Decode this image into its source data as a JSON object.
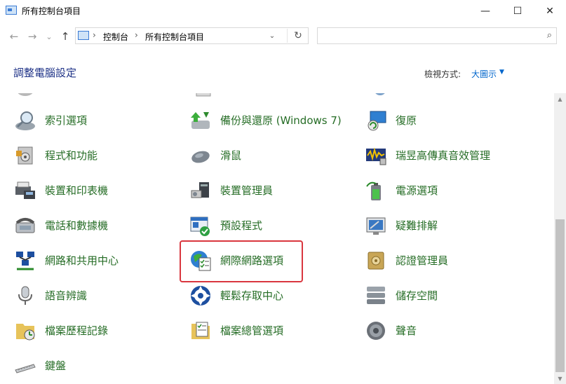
{
  "window": {
    "title": "所有控制台項目",
    "minimize": "—",
    "maximize": "☐",
    "close": "✕"
  },
  "nav": {
    "back": "←",
    "forward": "→",
    "recent": "⌄",
    "up": "↑"
  },
  "address": {
    "crumb1": "控制台",
    "crumb2": "所有控制台項目",
    "sep": "›",
    "dropdown": "⌄",
    "refresh": "↻"
  },
  "search": {
    "placeholder": "",
    "icon": "⌕"
  },
  "header": {
    "title": "調整電腦設定",
    "view_by_label": "檢視方式:",
    "view_by_value": "大圖示",
    "caret": "▼"
  },
  "items": [
    {
      "label": "索引選項",
      "icon": "search-index-icon"
    },
    {
      "label": "備份與還原 (Windows 7)",
      "icon": "backup-restore-icon"
    },
    {
      "label": "復原",
      "icon": "recovery-icon"
    },
    {
      "label": "程式和功能",
      "icon": "programs-features-icon"
    },
    {
      "label": "滑鼠",
      "icon": "mouse-icon"
    },
    {
      "label": "瑞昱高傳真音效管理",
      "icon": "realtek-audio-icon"
    },
    {
      "label": "裝置和印表機",
      "icon": "devices-printers-icon"
    },
    {
      "label": "裝置管理員",
      "icon": "device-manager-icon"
    },
    {
      "label": "電源選項",
      "icon": "power-options-icon"
    },
    {
      "label": "電話和數據機",
      "icon": "phone-modem-icon"
    },
    {
      "label": "預設程式",
      "icon": "default-programs-icon"
    },
    {
      "label": "疑難排解",
      "icon": "troubleshooting-icon"
    },
    {
      "label": "網路和共用中心",
      "icon": "network-sharing-icon"
    },
    {
      "label": "網際網路選項",
      "icon": "internet-options-icon"
    },
    {
      "label": "認證管理員",
      "icon": "credential-manager-icon"
    },
    {
      "label": "語音辨識",
      "icon": "speech-recognition-icon"
    },
    {
      "label": "輕鬆存取中心",
      "icon": "ease-of-access-icon"
    },
    {
      "label": "儲存空間",
      "icon": "storage-spaces-icon"
    },
    {
      "label": "檔案歷程記錄",
      "icon": "file-history-icon"
    },
    {
      "label": "檔案總管選項",
      "icon": "file-explorer-options-icon"
    },
    {
      "label": "聲音",
      "icon": "sound-icon"
    },
    {
      "label": "鍵盤",
      "icon": "keyboard-icon"
    }
  ],
  "scroll": {
    "up": "▲",
    "down": "▼"
  },
  "colors": {
    "link_green": "#266d26",
    "title_blue": "#1e3287",
    "highlight_red": "#d9363e",
    "view_blue": "#0066cc"
  }
}
